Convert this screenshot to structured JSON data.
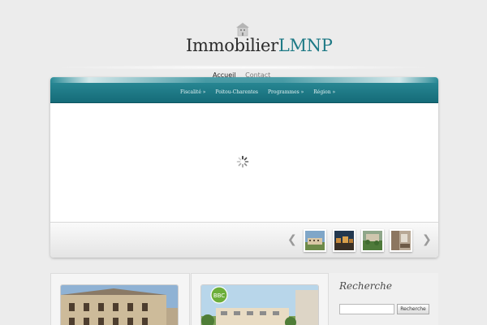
{
  "site": {
    "logo_main": "Immobilier",
    "logo_accent": "LMNP"
  },
  "topnav": {
    "items": [
      {
        "label": "Accueil",
        "active": true
      },
      {
        "label": "Contact",
        "active": false
      }
    ]
  },
  "catmenu": {
    "items": [
      "Fiscalité »",
      "Poitou-Charentes",
      "Programmes »",
      "Région »"
    ]
  },
  "slider": {
    "thumbnails": [
      "building-thumb",
      "city-night-thumb",
      "garden-thumb",
      "interior-thumb"
    ]
  },
  "sidebar": {
    "title": "Recherche",
    "search_button": "Recherche",
    "search_value": ""
  },
  "colors": {
    "accent": "#1f7a86",
    "bar": "#1a7b87",
    "background": "#ececec"
  }
}
